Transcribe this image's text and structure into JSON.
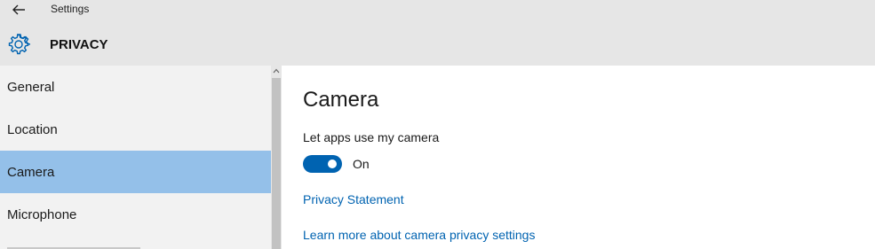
{
  "window": {
    "title": "Settings",
    "back_icon": "back-arrow-icon"
  },
  "header": {
    "icon": "gear-icon",
    "section": "PRIVACY",
    "accent_color": "#0063b1"
  },
  "sidebar": {
    "items": [
      {
        "label": "General",
        "selected": false
      },
      {
        "label": "Location",
        "selected": false
      },
      {
        "label": "Camera",
        "selected": true
      },
      {
        "label": "Microphone",
        "selected": false
      }
    ],
    "selected_color": "#94c0e9"
  },
  "main": {
    "title": "Camera",
    "setting_label": "Let apps use my camera",
    "toggle": {
      "state_label": "On",
      "on": true
    },
    "links": {
      "privacy_statement": "Privacy Statement",
      "learn_more": "Learn more about camera privacy settings"
    }
  }
}
